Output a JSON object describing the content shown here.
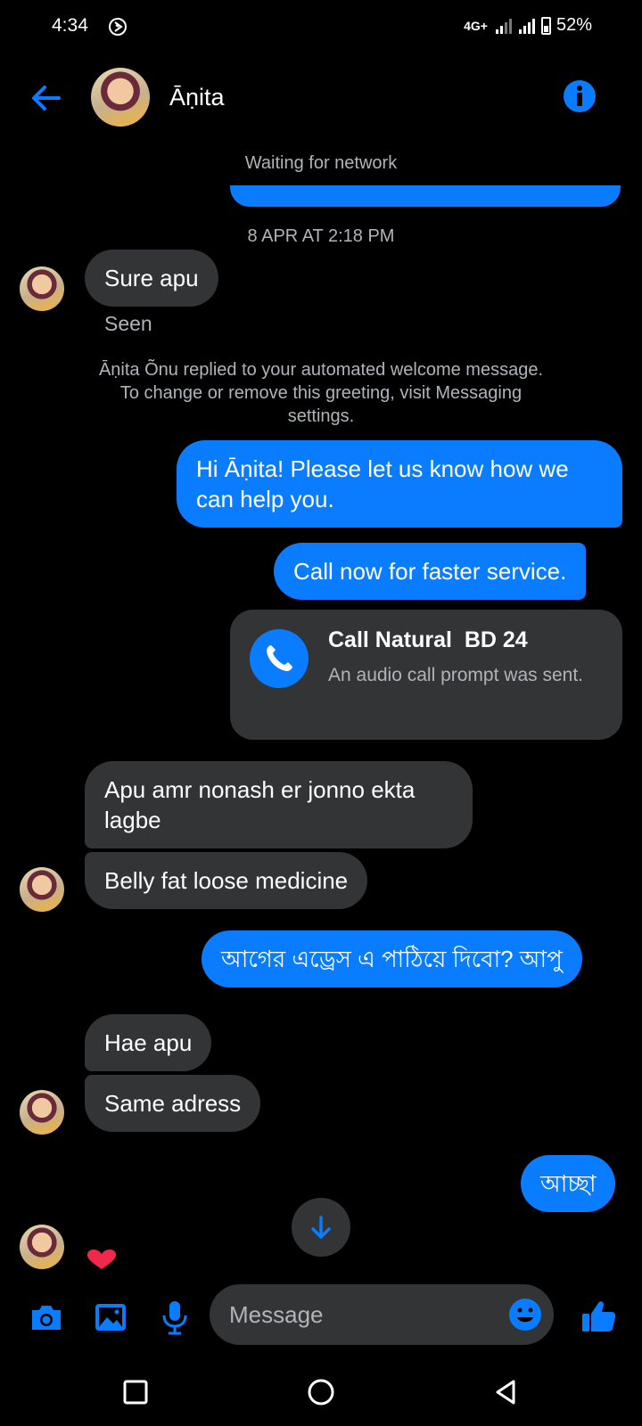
{
  "status_bar": {
    "time": "4:34",
    "network": "4G+",
    "battery": "52%"
  },
  "header": {
    "contact_name": "Āṇita"
  },
  "chat": {
    "network_status": "Waiting for network",
    "timestamp": "8 APR AT 2:18 PM",
    "seen_label": "Seen",
    "system_note": "Āṇita Õnu replied to your automated welcome message. To change or remove this greeting, visit Messaging settings.",
    "messages": [
      {
        "text": "Sure apu"
      },
      {
        "text": "Hi Āṇita! Please let us know how we can help you."
      },
      {
        "text": "Call now for faster service."
      },
      {
        "text": "Apu amr nonash er jonno ekta lagbe"
      },
      {
        "text": "Belly fat loose medicine"
      },
      {
        "text": "আগের এড্রেস এ পাঠিয়ে দিবো? আপু"
      },
      {
        "text": "Hae apu"
      },
      {
        "text": "Same adress"
      },
      {
        "text": "আচ্ছা"
      }
    ],
    "call_card": {
      "title": "Call Natural  BD 24",
      "description": "An audio call prompt was sent."
    },
    "reaction": "heart"
  },
  "composer": {
    "placeholder": "Message"
  },
  "colors": {
    "accent": "#0a7cff",
    "incoming_bubble": "#333436",
    "secondary_text": "#b0b3b8"
  }
}
